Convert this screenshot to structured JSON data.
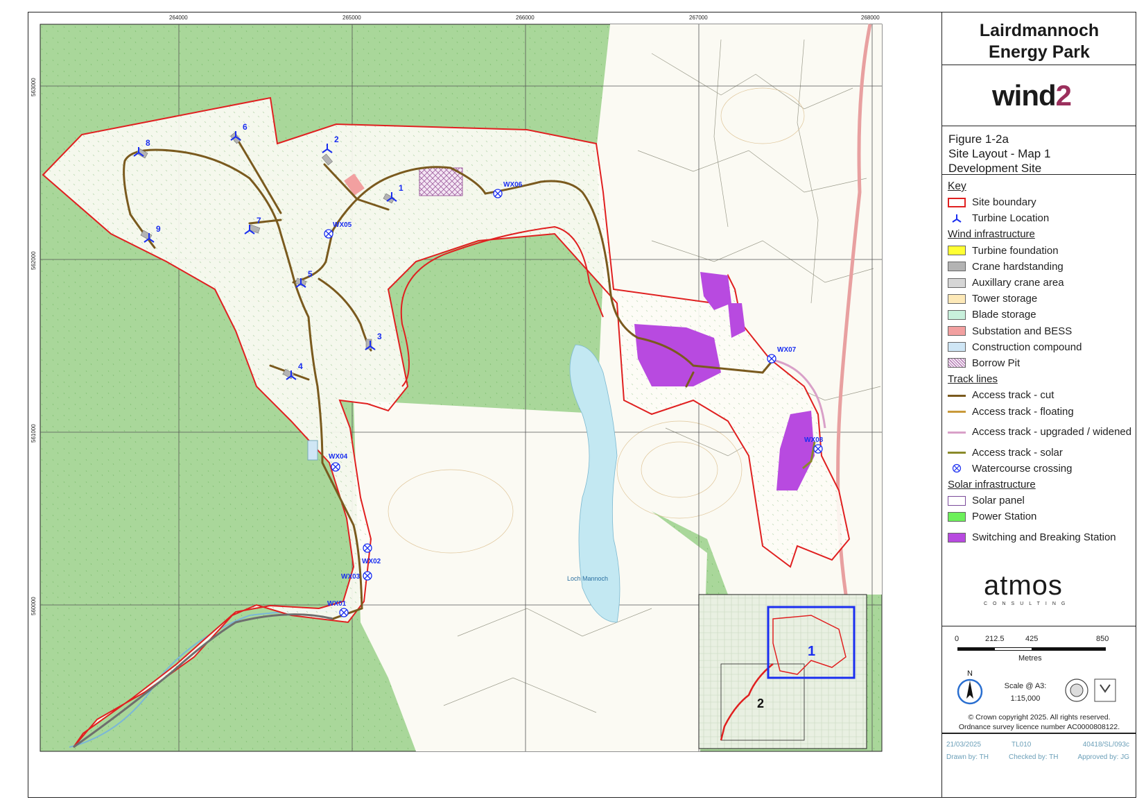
{
  "title": {
    "line1": "Lairdmannoch",
    "line2": "Energy Park"
  },
  "client_logo": "wind2",
  "figure": {
    "number": "Figure 1-2a",
    "name": "Site Layout - Map 1",
    "subtitle": "Development Site"
  },
  "key": {
    "heading": "Key",
    "site_boundary": "Site boundary",
    "turbine_location": "Turbine Location",
    "wind_heading": "Wind infrastructure",
    "wind_items": [
      {
        "label": "Turbine foundation",
        "color": "#ffff33"
      },
      {
        "label": "Crane hardstanding",
        "color": "#b3b3b3"
      },
      {
        "label": "Auxillary crane area",
        "color": "#d6d6d6"
      },
      {
        "label": "Tower storage",
        "color": "#fde9b8"
      },
      {
        "label": "Blade storage",
        "color": "#c8f0dc"
      },
      {
        "label": "Substation and BESS",
        "color": "#f2a0a0"
      },
      {
        "label": "Construction compound",
        "color": "#cfe6f5"
      },
      {
        "label": "Borrow Pit",
        "color": "#b070b0"
      }
    ],
    "track_heading": "Track lines",
    "track_items": [
      {
        "label": "Access track - cut",
        "color": "#7a5a1e"
      },
      {
        "label": "Access track - floating",
        "color": "#c99a3a"
      },
      {
        "label": "Access track - upgraded / widened",
        "color": "#d9a0c8"
      },
      {
        "label": "Access track - solar",
        "color": "#8a8a2a"
      }
    ],
    "watercourse_crossing": "Watercourse crossing",
    "solar_heading": "Solar infrastructure",
    "solar_items": [
      {
        "label": "Solar panel",
        "color": "#ffffff",
        "border": "#7a4a9a"
      },
      {
        "label": "Power Station",
        "color": "#6cf05a"
      },
      {
        "label": "Switching and Breaking Station",
        "color": "#b84ae0"
      }
    ]
  },
  "consultant_logo": {
    "name": "atmos",
    "tagline": "CONSULTING"
  },
  "scale_bar": {
    "ticks": [
      "0",
      "212.5",
      "425",
      "850"
    ],
    "unit": "Metres"
  },
  "north": "N",
  "scale": {
    "label": "Scale @ A3:",
    "value": "1:15,000"
  },
  "copyright": {
    "line1": "© Crown copyright 2025. All rights reserved.",
    "line2": "Ordnance survey licence number AC0000808122."
  },
  "footer": {
    "date": "21/03/2025",
    "code": "TL010",
    "ref": "40418/SL/093c",
    "drawn": "Drawn by: TH",
    "checked": "Checked by: TH",
    "approved": "Approved by: JG"
  },
  "grid": {
    "eastings": [
      "264000",
      "265000",
      "266000",
      "267000",
      "268000"
    ],
    "northings": [
      "563000",
      "562000",
      "561000",
      "560000"
    ]
  },
  "turbines": [
    "1",
    "2",
    "3",
    "4",
    "5",
    "6",
    "7",
    "8",
    "9"
  ],
  "crossings": [
    "WX01",
    "WX02",
    "WX03",
    "WX04",
    "WX05",
    "WX06",
    "WX07",
    "WX08"
  ],
  "place_labels": {
    "loch": "Loch Mannoch"
  },
  "inset_maps": [
    "1",
    "2"
  ]
}
